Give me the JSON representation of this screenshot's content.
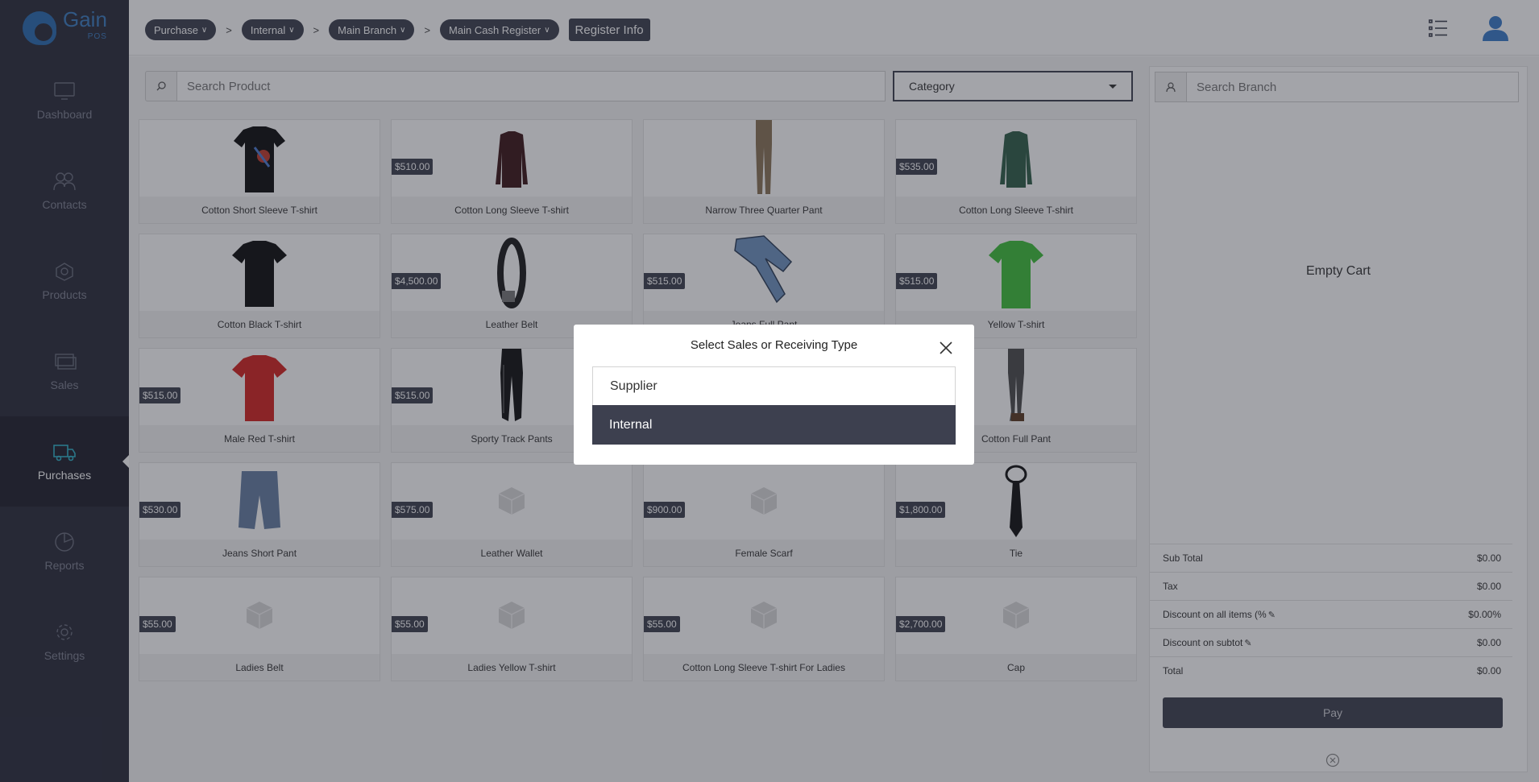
{
  "brand": {
    "name": "Gain",
    "sub": "POS"
  },
  "sidebar": {
    "items": [
      {
        "label": "Dashboard",
        "icon": "monitor-icon"
      },
      {
        "label": "Contacts",
        "icon": "users-icon"
      },
      {
        "label": "Products",
        "icon": "products-icon"
      },
      {
        "label": "Sales",
        "icon": "sales-icon"
      },
      {
        "label": "Purchases",
        "icon": "truck-icon",
        "active": true
      },
      {
        "label": "Reports",
        "icon": "pie-chart-icon"
      },
      {
        "label": "Settings",
        "icon": "gear-icon"
      }
    ]
  },
  "header": {
    "crumbs": [
      "Purchase",
      "Internal",
      "Main Branch",
      "Main Cash Register"
    ],
    "separator": ">",
    "register_info": "Register Info"
  },
  "main": {
    "search_placeholder": "Search Product",
    "category_label": "Category",
    "products": [
      {
        "name": "Cotton Short Sleeve T-shirt",
        "price": "",
        "img": "tshirt-black-print"
      },
      {
        "name": "Cotton Long Sleeve T-shirt",
        "price": "$510.00",
        "img": "longsleeve-maroon"
      },
      {
        "name": "Narrow Three Quarter Pant",
        "price": "",
        "img": "pant-khaki"
      },
      {
        "name": "Cotton Long Sleeve T-shirt",
        "price": "$535.00",
        "img": "longsleeve-green"
      },
      {
        "name": "Cotton Black T-shirt",
        "price": "",
        "img": "tshirt-black"
      },
      {
        "name": "Leather Belt",
        "price": "$4,500.00",
        "img": "belt"
      },
      {
        "name": "Jeans Full Pant",
        "price": "$515.00",
        "img": "jeans"
      },
      {
        "name": "Yellow T-shirt",
        "price": "$515.00",
        "img": "tshirt-green"
      },
      {
        "name": "Male Red T-shirt",
        "price": "$515.00",
        "img": "tshirt-red"
      },
      {
        "name": "Sporty Track Pants",
        "price": "$515.00",
        "img": "trackpants"
      },
      {
        "name": "",
        "price": "",
        "img": "none"
      },
      {
        "name": "Cotton Full Pant",
        "price": "",
        "img": "pant-grey"
      },
      {
        "name": "Jeans Short Pant",
        "price": "$530.00",
        "img": "shorts"
      },
      {
        "name": "Leather Wallet",
        "price": "$575.00",
        "img": "box"
      },
      {
        "name": "Female Scarf",
        "price": "$900.00",
        "img": "box"
      },
      {
        "name": "Tie",
        "price": "$1,800.00",
        "img": "tie"
      },
      {
        "name": "Ladies Belt",
        "price": "$55.00",
        "img": "box"
      },
      {
        "name": "Ladies Yellow T-shirt",
        "price": "$55.00",
        "img": "box"
      },
      {
        "name": "Cotton Long Sleeve T-shirt For Ladies",
        "price": "$55.00",
        "img": "box"
      },
      {
        "name": "Cap",
        "price": "$2,700.00",
        "img": "box"
      }
    ]
  },
  "cart": {
    "search_placeholder": "Search Branch",
    "empty_text": "Empty Cart",
    "rows": [
      {
        "label": "Sub Total",
        "value": "$0.00",
        "edit": false
      },
      {
        "label": "Tax",
        "value": "$0.00",
        "edit": false
      },
      {
        "label": "Discount on all items (%",
        "value": "$0.00%",
        "edit": true
      },
      {
        "label": "Discount on subtot",
        "value": "$0.00",
        "edit": true
      },
      {
        "label": "Total",
        "value": "$0.00",
        "edit": false
      }
    ],
    "pay_label": "Pay"
  },
  "modal": {
    "title": "Select Sales or Receiving Type",
    "options": [
      "Supplier",
      "Internal"
    ],
    "selected": "Internal"
  },
  "colors": {
    "sidebar_bg": "#2a2c3a",
    "accent": "#3d404f",
    "active_icon": "#31b1c9",
    "brand": "#2a6bb0"
  }
}
